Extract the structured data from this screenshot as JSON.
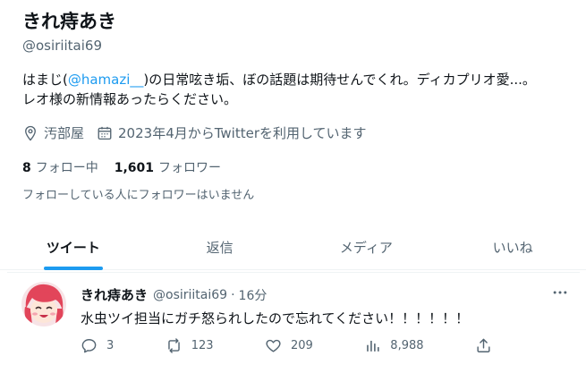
{
  "profile": {
    "display_name": "きれ痔あき",
    "handle": "@osiriitai69",
    "bio_prefix": "はまじ(",
    "bio_link": "@hamazi__",
    "bio_middle": ")の日常呟き垢、ぼの話題は期待せんでくれ。ディカプリオ愛...。",
    "bio_line2": "レオ様の新情報あったらください。",
    "location": "汚部屋",
    "joined": "2023年4月からTwitterを利用しています",
    "following_count": "8",
    "following_label": "フォロー中",
    "followers_count": "1,601",
    "followers_label": "フォロワー",
    "followers_note": "フォローしている人にフォロワーはいません"
  },
  "tabs": [
    {
      "label": "ツイート"
    },
    {
      "label": "返信"
    },
    {
      "label": "メディア"
    },
    {
      "label": "いいね"
    }
  ],
  "tweet": {
    "name": "きれ痔あき",
    "handle": "@osiriitai69",
    "dot": "·",
    "time": "16分",
    "text": "水虫ツイ担当にガチ怒られしたので忘れてください！！！！！！",
    "replies": "3",
    "retweets": "123",
    "likes": "209",
    "views": "8,988"
  },
  "colors": {
    "accent": "#1d9bf0",
    "text": "#0f1419",
    "muted": "#536471"
  }
}
